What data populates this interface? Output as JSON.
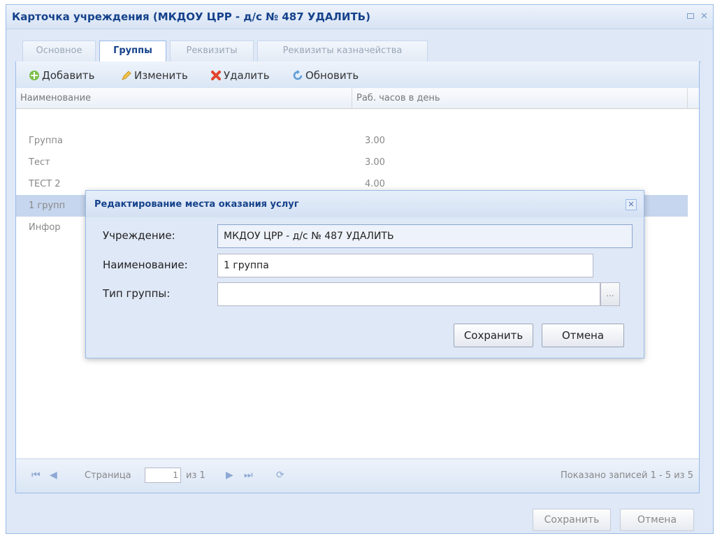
{
  "window": {
    "title": "Карточка учреждения (МКДОУ ЦРР - д/с № 487 УДАЛИТЬ)"
  },
  "tabs": [
    {
      "label": "Основное",
      "active": false
    },
    {
      "label": "Группы",
      "active": true
    },
    {
      "label": "Реквизиты",
      "active": false
    },
    {
      "label": "Реквизиты казначейства",
      "active": false
    }
  ],
  "toolbar": {
    "add": "Добавить",
    "edit": "Изменить",
    "delete": "Удалить",
    "refresh": "Обновить"
  },
  "grid": {
    "columns": [
      "Наименование",
      "Раб. часов в день"
    ],
    "rows": [
      {
        "name": "Группа",
        "hours": "3.00"
      },
      {
        "name": "Тест",
        "hours": "3.00"
      },
      {
        "name": "ТЕСТ 2",
        "hours": "4.00"
      },
      {
        "name": "1 групп",
        "hours": ""
      },
      {
        "name": "Инфор",
        "hours": ""
      }
    ]
  },
  "paging": {
    "page_label": "Страница",
    "page_value": "1",
    "of_label": "из 1",
    "summary": "Показано записей 1 - 5 из 5"
  },
  "footer": {
    "save": "Сохранить",
    "cancel": "Отмена"
  },
  "modal": {
    "title": "Редактирование места оказания услуг",
    "institution_label": "Учреждение:",
    "institution_value": "МКДОУ ЦРР - д/с № 487 УДАЛИТЬ",
    "name_label": "Наименование:",
    "name_value": "1 группа",
    "type_label": "Тип группы:",
    "type_value": "",
    "trigger": "...",
    "save": "Сохранить",
    "cancel": "Отмена"
  },
  "colors": {
    "header_blue": "#15428b",
    "frame": "#99bbe8",
    "selected_row": "#c6d6ee"
  }
}
